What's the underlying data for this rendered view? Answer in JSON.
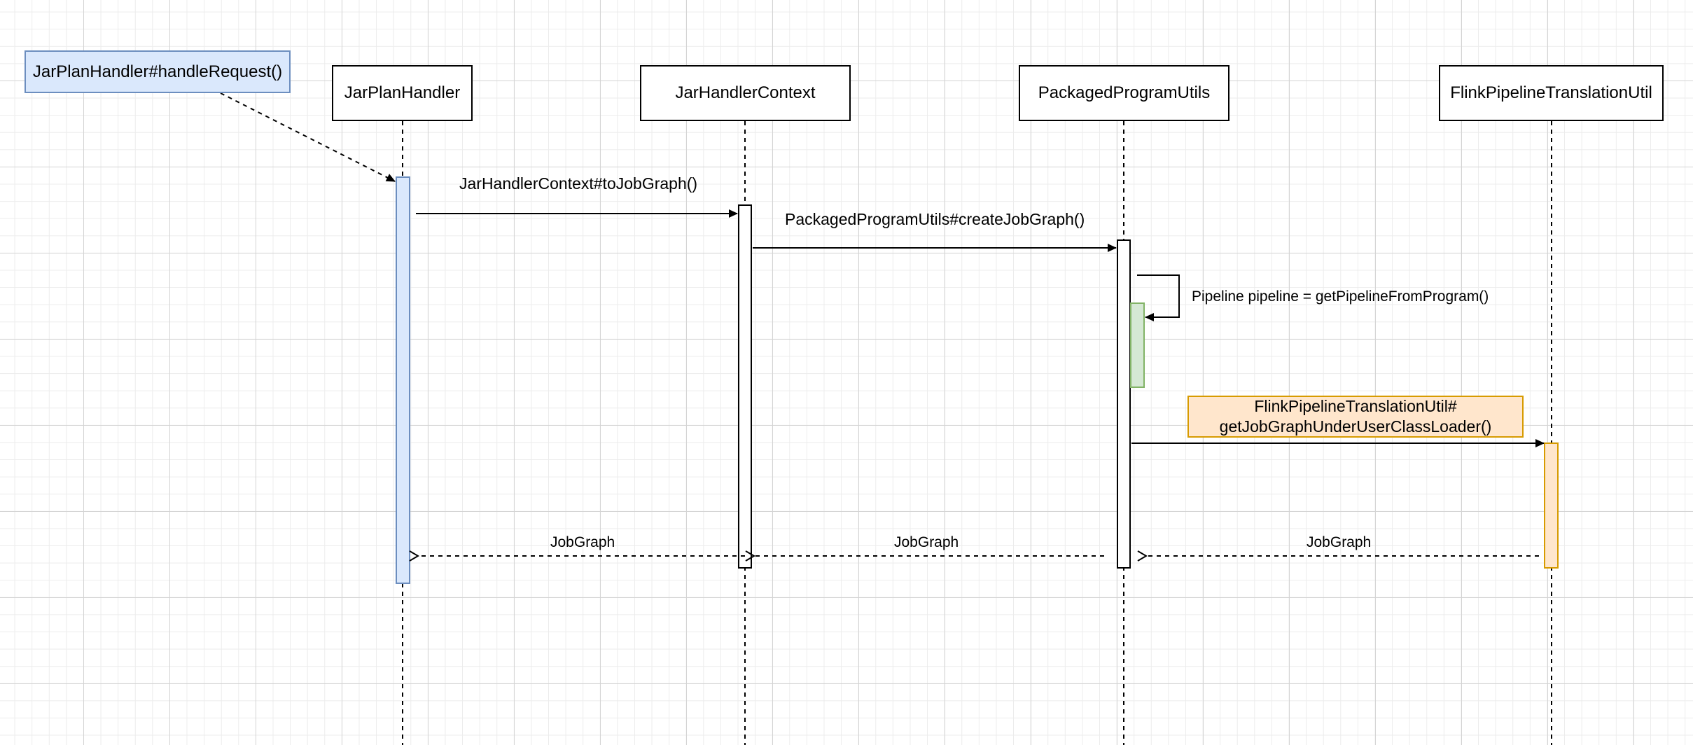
{
  "diagram": {
    "trigger_note": "JarPlanHandler#handleRequest()",
    "participants": [
      {
        "id": "jar_plan_handler",
        "label": "JarPlanHandler"
      },
      {
        "id": "jar_handler_context",
        "label": "JarHandlerContext"
      },
      {
        "id": "packaged_program_utils",
        "label": "PackagedProgramUtils"
      },
      {
        "id": "flink_pipeline_translation_util",
        "label": "FlinkPipelineTranslationUtil"
      }
    ],
    "messages": {
      "to_job_graph": "JarHandlerContext#toJobGraph()",
      "create_job_graph": "PackagedProgramUtils#createJobGraph()",
      "self_call": "Pipeline pipeline = getPipelineFromProgram()",
      "translation_line1": "FlinkPipelineTranslationUtil#",
      "translation_line2": "getJobGraphUnderUserClassLoader()",
      "returns": [
        "JobGraph",
        "JobGraph",
        "JobGraph"
      ]
    },
    "colors": {
      "blue_fill": "#dae8fc",
      "blue_stroke": "#6c8ebf",
      "green_fill": "#d5e8d4",
      "green_stroke": "#82b366",
      "orange_fill": "#ffe6cc",
      "orange_stroke": "#d79b00"
    }
  }
}
